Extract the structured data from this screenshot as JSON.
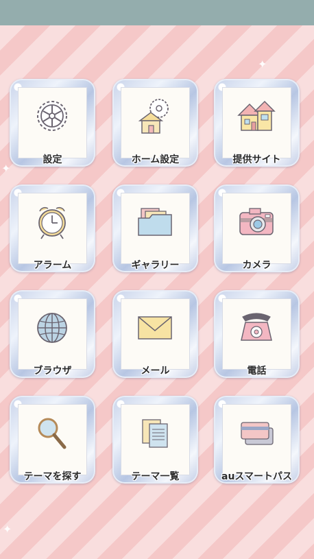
{
  "screen": {
    "tiles": [
      {
        "label": "設定",
        "icon": "gear-icon"
      },
      {
        "label": "ホーム設定",
        "icon": "home-settings-icon"
      },
      {
        "label": "提供サイト",
        "icon": "house-icon"
      },
      {
        "label": "アラーム",
        "icon": "alarm-clock-icon"
      },
      {
        "label": "ギャラリー",
        "icon": "folder-icon"
      },
      {
        "label": "カメラ",
        "icon": "camera-icon"
      },
      {
        "label": "ブラウザ",
        "icon": "globe-icon"
      },
      {
        "label": "メール",
        "icon": "envelope-icon"
      },
      {
        "label": "電話",
        "icon": "telephone-icon"
      },
      {
        "label": "テーマを探す",
        "icon": "magnifier-icon"
      },
      {
        "label": "テーマ一覧",
        "icon": "documents-icon"
      },
      {
        "label": "auスマートパス",
        "icon": "cards-icon"
      }
    ]
  },
  "colors": {
    "status_bar": "#94adad",
    "stripe_light": "#f9dede",
    "stripe_dark": "#f5c8c8",
    "frame": "#c2cde6",
    "tile_inner": "#fdfbf6"
  }
}
